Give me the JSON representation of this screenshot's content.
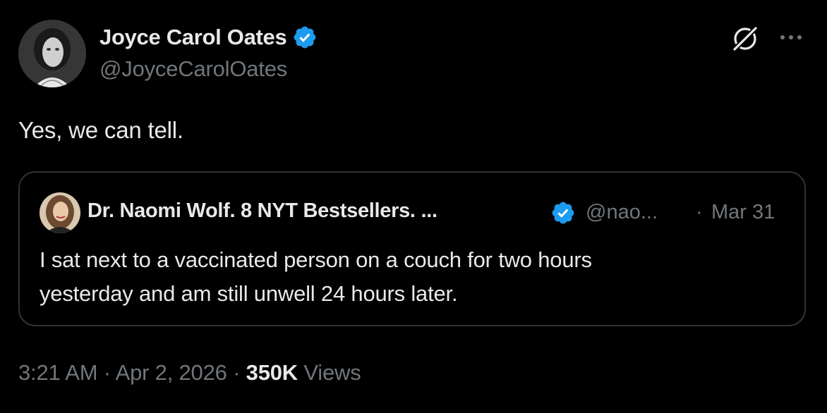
{
  "author": {
    "name": "Joyce Carol Oates",
    "handle": "@JoyceCarolOates",
    "verified": true,
    "avatar_icon": "author-portrait"
  },
  "header_actions": {
    "grok_icon": "grok-icon",
    "more_icon": "more-icon"
  },
  "tweet": {
    "text": "Yes, we can tell."
  },
  "quoted_tweet": {
    "author_name": "Dr. Naomi Wolf. 8 NYT Bestsellers. ...",
    "verified": true,
    "handle": "@nao...",
    "separator": "·",
    "date": "Mar 31",
    "text_line_1": "I sat next to a vaccinated person on a couch for two hours",
    "text_line_2": "yesterday and am still unwell 24 hours later."
  },
  "meta": {
    "time": "3:21 AM",
    "sep1": "·",
    "date": "Apr 2, 2026",
    "sep2": "·",
    "views_count": "350K",
    "views_label": "Views"
  },
  "colors": {
    "background": "#000000",
    "primary_text": "#e7e9ea",
    "secondary_text": "#71767b",
    "verified_blue": "#1d9bf0",
    "border": "#2f3336"
  }
}
